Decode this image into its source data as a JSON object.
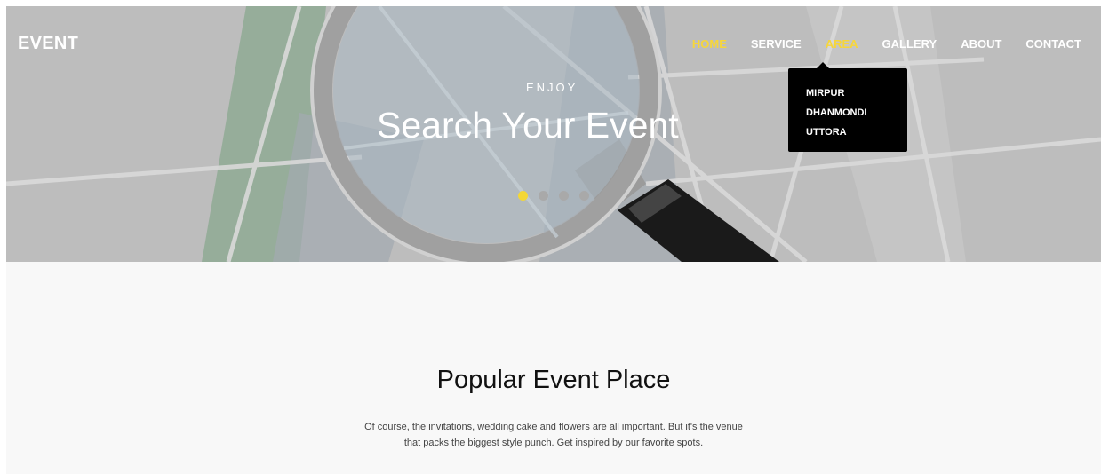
{
  "brand": "EVENT",
  "nav": {
    "items": [
      {
        "label": "HOME",
        "active": true
      },
      {
        "label": "SERVICE",
        "active": false
      },
      {
        "label": "AREA",
        "active": true
      },
      {
        "label": "GALLERY",
        "active": false
      },
      {
        "label": "ABOUT",
        "active": false
      },
      {
        "label": "CONTACT",
        "active": false
      }
    ],
    "area_dropdown": [
      "MIRPUR",
      "DHANMONDI",
      "UTTORA"
    ]
  },
  "hero": {
    "kicker": "ENJOY",
    "headline": "Search Your Event",
    "slides": 4,
    "active_slide": 1
  },
  "section": {
    "title": "Popular Event Place",
    "text_line1": "Of course, the invitations, wedding cake and flowers are all important. But it's the venue",
    "text_line2": "that packs the biggest style punch. Get inspired by our favorite spots."
  },
  "colors": {
    "accent": "#f6d63b",
    "hero_overlay": "#b7b7b7",
    "dropdown_bg": "#000000",
    "section_bg": "#f8f8f8"
  },
  "icons": [
    "magnifying-glass-illustration"
  ]
}
